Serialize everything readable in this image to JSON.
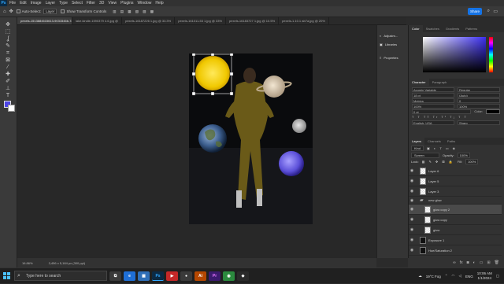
{
  "app": {
    "logo": "Ps"
  },
  "menu": [
    "File",
    "Edit",
    "Image",
    "Layer",
    "Type",
    "Select",
    "Filter",
    "3D",
    "View",
    "Plugins",
    "Window",
    "Help"
  ],
  "options": {
    "auto_select": "Auto-Select:",
    "layer_value": "Layer",
    "show_transform": "Show Transform Controls",
    "share": "Share"
  },
  "tabs": [
    "pexels-1513884615613-9031546b-78(jpg @ 16.7% (van copy 2, RGB/8*)",
    "lake.kindle-1590379 4.6.jpg @",
    "pexels-16187226 1.jpg @ 33.3%",
    "pexels-161011-53 1.jpg @ 33%",
    "pexels-16183727 1.jpg @ 10.5%",
    "pexels-1.10.1 ab7a.jpg @ 20%"
  ],
  "icons": {
    "move": "move-icon",
    "marquee": "marquee-icon",
    "lasso": "lasso-icon",
    "brush": "brush-icon",
    "type": "type-icon"
  },
  "right_strip": [
    "Adjustm...",
    "Libraries",
    "Properties"
  ],
  "color_panel": {
    "tabs": [
      "Color",
      "Swatches",
      "Gradients",
      "Patterns"
    ]
  },
  "character_panel": {
    "tabs": [
      "Character",
      "Paragraph"
    ],
    "font": "Acumin Variable",
    "style": "Regular",
    "size": "18 pt",
    "leading": "(Auto)",
    "kerning": "Metrics",
    "tracking": "0",
    "scale_v": "100%",
    "scale_h": "100%",
    "baseline": "0 pt",
    "color_label": "Color:",
    "language": "English: USA",
    "aa": "Sharp"
  },
  "layers_panel": {
    "tabs": [
      "Layers",
      "Channels",
      "Paths"
    ],
    "kind": "Kind",
    "blend": "Screen",
    "opacity_label": "Opacity:",
    "opacity": "100%",
    "lock_label": "Lock:",
    "fill_label": "Fill:",
    "fill": "100%",
    "layers": [
      {
        "name": "Layer 6",
        "type": "layer",
        "selected": false
      },
      {
        "name": "Layer 5",
        "type": "layer",
        "selected": false
      },
      {
        "name": "Layer 3",
        "type": "layer",
        "selected": false
      },
      {
        "name": "new glow",
        "type": "folder",
        "selected": false
      },
      {
        "name": "glow copy 2",
        "type": "layer",
        "selected": true
      },
      {
        "name": "glow copy",
        "type": "layer",
        "selected": false
      },
      {
        "name": "glow",
        "type": "layer",
        "selected": false
      },
      {
        "name": "Exposure 1",
        "type": "adjust",
        "selected": false
      },
      {
        "name": "Hue/Saturation 2",
        "type": "adjust",
        "selected": false
      }
    ]
  },
  "status": {
    "zoom": "16.86%",
    "doc": "3,456 x 5,184 px (300 ppi)"
  },
  "taskbar": {
    "search_placeholder": "Type here to search",
    "weather": "19°C Fog",
    "lang": "ENG",
    "time": "10:06 AM",
    "date": "1/1/2024",
    "apps": [
      {
        "label": "e",
        "color": "#1f6fd6"
      },
      {
        "label": "▦",
        "color": "#2f6fb8"
      },
      {
        "label": "Ps",
        "color": "#0b2a44"
      },
      {
        "label": "▶",
        "color": "#c62828"
      },
      {
        "label": "●",
        "color": "#3a3a3a"
      },
      {
        "label": "Ai",
        "color": "#b54700"
      },
      {
        "label": "Pr",
        "color": "#3b1a6e"
      },
      {
        "label": "◉",
        "color": "#2b8a3e"
      },
      {
        "label": "◆",
        "color": "#2a2a2a"
      }
    ]
  }
}
